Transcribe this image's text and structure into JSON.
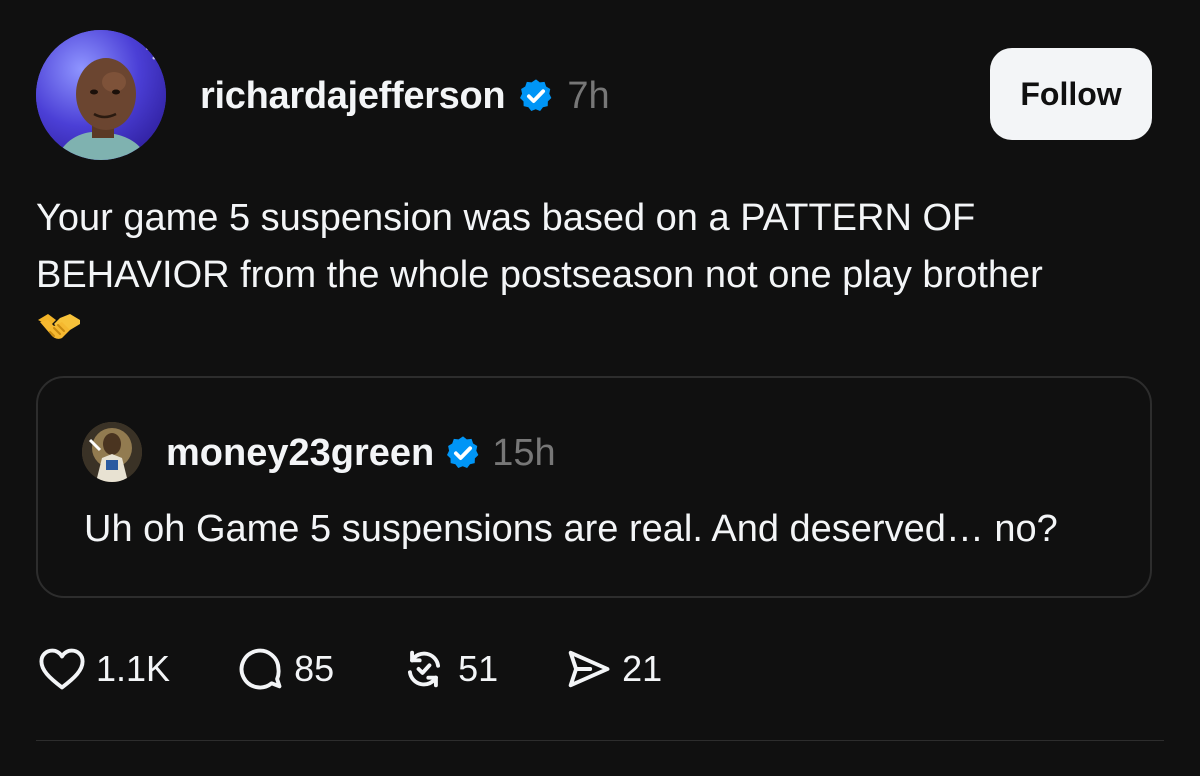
{
  "post": {
    "username": "richardajefferson",
    "timestamp": "7h",
    "verified": true,
    "follow_label": "Follow",
    "text": "Your game 5 suspension was based on a PATTERN OF BEHAVIOR from the whole postseason not one play brother",
    "emoji": "handshake-emoji"
  },
  "quoted_post": {
    "username": "money23green",
    "timestamp": "15h",
    "verified": true,
    "text": "Uh oh Game 5 suspensions are real. And deserved… no?"
  },
  "actions": {
    "likes": "1.1K",
    "replies": "85",
    "reposts": "51",
    "shares": "21"
  },
  "icons": {
    "like": "heart-icon",
    "reply": "comment-icon",
    "repost": "repost-icon",
    "share": "send-icon",
    "verified": "verified-badge-icon"
  },
  "colors": {
    "background": "#101010",
    "text": "#f3f5f7",
    "secondary_text": "#777777",
    "verified_blue": "#0095f6",
    "border": "#2d2d2d",
    "follow_button_bg": "#f3f5f7"
  }
}
